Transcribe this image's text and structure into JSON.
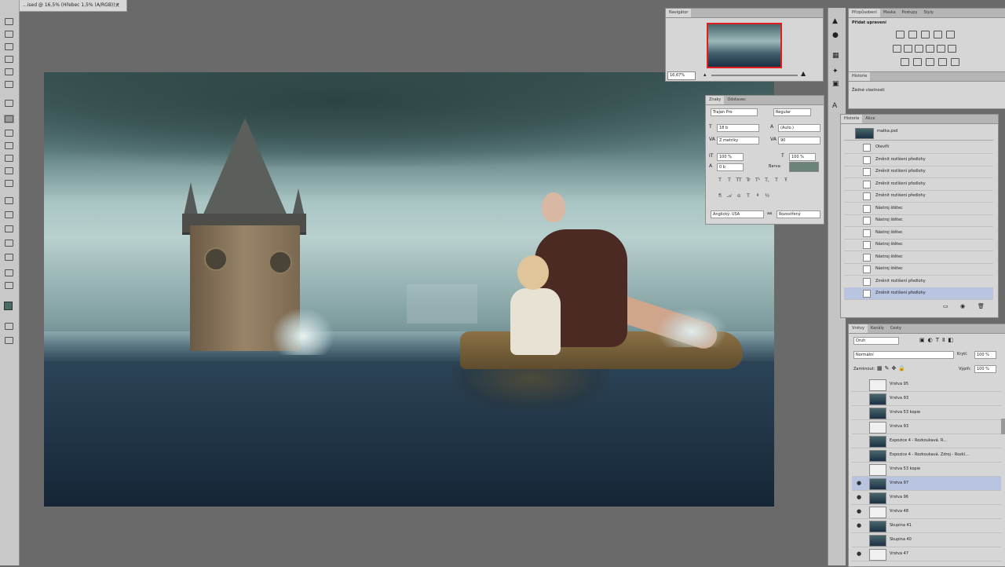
{
  "document": {
    "tab_title": "...ised @ 16,5% (Hřebec 1,5% (A/RGB)) *"
  },
  "canvas": {
    "alt": ""
  },
  "navigator": {
    "tabs": [
      "Navigátor"
    ],
    "zoom_value": "16,67%"
  },
  "character": {
    "tabs": [
      "Znaky",
      "Odstavec"
    ],
    "font_family": "Trajan Pro",
    "font_style": "Regular",
    "font_size": "18 b",
    "leading": "(Auto.)",
    "kerning": "Z metriky",
    "tracking": "90",
    "vscale": "100 %",
    "hscale": "100 %",
    "baseline": "0 b",
    "color_label": "Barva:",
    "color_hex": "#6b8478",
    "style_glyphs": [
      "T",
      "T",
      "TT",
      "Tr",
      "T¹",
      "T,",
      "T",
      "Ŧ"
    ],
    "language": "Anglický: USA",
    "aa_label": "aa",
    "aa_mode": "Rozostřený"
  },
  "adjustments": {
    "tabs": [
      "Přizpůsobení",
      "Maska",
      "Postupy",
      "Styly"
    ],
    "heading": "Přidat upravení"
  },
  "masks": {
    "tabs": [
      "Historie"
    ],
    "heading": "Žádné  vlastnosti"
  },
  "history": {
    "tabs": [
      "Historie",
      "Akce"
    ],
    "snapshot": "matka.psd",
    "items": [
      "Otevřít",
      "Změnit rozlišení předlohy",
      "Změnit rozlišení předlohy",
      "Změnit rozlišení předlohy",
      "Změnit rozlišení předlohy",
      "Nástroj štětec",
      "Nástroj štětec",
      "Nástroj štětec",
      "Nástroj štětec",
      "Nástroj štětec",
      "Nástroj štětec",
      "Změnit rozlišení předlohy",
      "Změnit rozlišení předlohy"
    ]
  },
  "layers": {
    "tabs": [
      "Vrstvy",
      "Kanály",
      "Cesty"
    ],
    "kind_filter": "Druh",
    "blend_mode": "Normální",
    "opacity_label": "Krytí:",
    "opacity_value": "100 %",
    "lock_label": "Zamknout:",
    "fill_label": "Výplň:",
    "fill_value": "100 %",
    "rows": [
      {
        "name": "Vrstva 95",
        "eye": false,
        "sel": false
      },
      {
        "name": "Vrstva 93",
        "eye": false,
        "sel": false
      },
      {
        "name": "Vrstva 53 kopie",
        "eye": false,
        "sel": false
      },
      {
        "name": "Vrstva 93",
        "eye": false,
        "sel": false
      },
      {
        "name": "Expozice 4 - Rozkoukavá. R...",
        "eye": false,
        "sel": false
      },
      {
        "name": "Expozice 4 - Rozkoukavá. Zdroj - Rozkl...",
        "eye": false,
        "sel": false
      },
      {
        "name": "Vrstva 53 kopie",
        "eye": false,
        "sel": false
      },
      {
        "name": "Vrstva 97",
        "eye": true,
        "sel": true
      },
      {
        "name": "Vrstva 96",
        "eye": true,
        "sel": false
      },
      {
        "name": "Vrstva 48",
        "eye": true,
        "sel": false
      },
      {
        "name": "Skupina 41",
        "eye": true,
        "sel": false
      },
      {
        "name": "Skupina 40",
        "eye": false,
        "sel": false
      },
      {
        "name": "Vrstva 47",
        "eye": true,
        "sel": false
      }
    ]
  },
  "colors": {
    "panel": "#d6d6d6",
    "workspace": "#6a6a6a",
    "selection": "#b8c4e0"
  }
}
